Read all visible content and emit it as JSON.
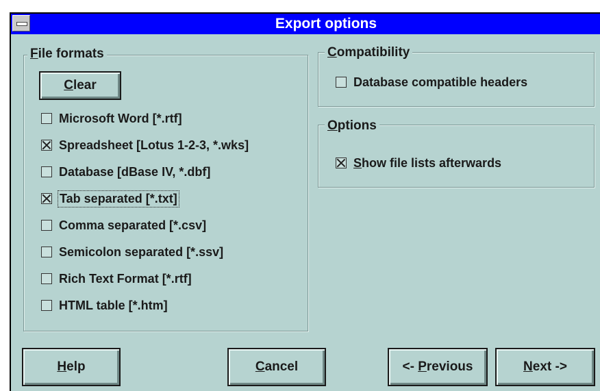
{
  "window": {
    "title": "Export options"
  },
  "file_formats": {
    "title": "File formats",
    "title_underline": "F",
    "title_rest": "ile formats",
    "clear_button": {
      "underline": "C",
      "rest": "lear",
      "label": "Clear"
    },
    "items": [
      {
        "label": "Microsoft Word [*.rtf]",
        "checked": false
      },
      {
        "label": "Spreadsheet [Lotus 1-2-3, *.wks]",
        "checked": true
      },
      {
        "label": "Database [dBase IV, *.dbf]",
        "checked": false
      },
      {
        "label": "Tab separated [*.txt]",
        "checked": true,
        "focused": true
      },
      {
        "label": "Comma separated [*.csv]",
        "checked": false
      },
      {
        "label": "Semicolon separated [*.ssv]",
        "checked": false
      },
      {
        "label": "Rich Text Format [*.rtf]",
        "checked": false
      },
      {
        "label": "HTML table [*.htm]",
        "checked": false
      }
    ]
  },
  "compatibility": {
    "title_underline": "C",
    "title_rest": "ompatibility",
    "title": "Compatibility",
    "db_headers": {
      "label": "Database compatible headers",
      "checked": false
    }
  },
  "options": {
    "title_underline": "O",
    "title_rest": "ptions",
    "title": "Options",
    "show_lists": {
      "underline": "S",
      "rest": "how file lists afterwards",
      "label": "Show file lists afterwards",
      "checked": true
    }
  },
  "buttons": {
    "help": {
      "underline": "H",
      "rest": "elp",
      "label": "Help"
    },
    "cancel": {
      "underline": "C",
      "rest": "ancel",
      "label": "Cancel"
    },
    "previous": {
      "prefix": "<- ",
      "underline": "P",
      "rest": "revious",
      "label": "<- Previous"
    },
    "next": {
      "underline": "N",
      "rest": "ext ->",
      "label": "Next ->"
    }
  }
}
